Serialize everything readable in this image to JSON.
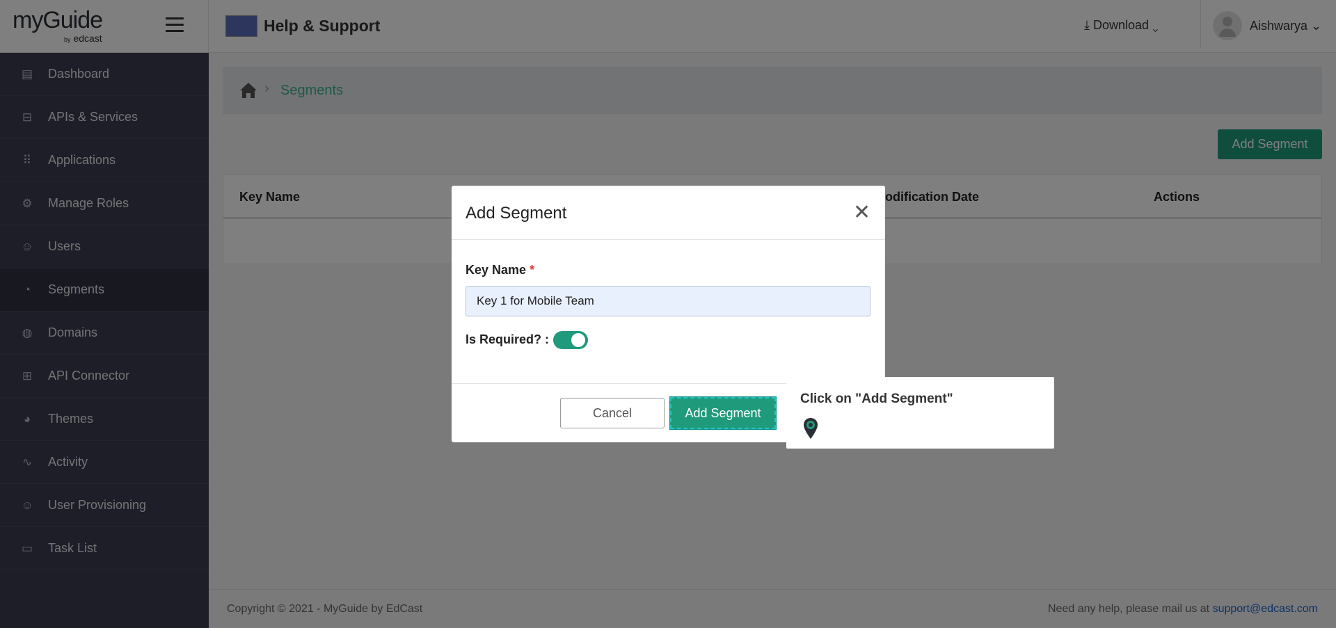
{
  "header": {
    "logo": "myGuide",
    "logo_sub_prefix": "by",
    "logo_sub": "edcast",
    "app_title": "Help & Support",
    "download_label": "Download",
    "username": "Aishwarya"
  },
  "sidebar": {
    "items": [
      {
        "label": "Dashboard",
        "icon": "dashboard-icon",
        "active": false
      },
      {
        "label": "APIs & Services",
        "icon": "api-icon",
        "active": false
      },
      {
        "label": "Applications",
        "icon": "grid-icon",
        "active": false
      },
      {
        "label": "Manage Roles",
        "icon": "user-gear-icon",
        "active": false
      },
      {
        "label": "Users",
        "icon": "users-icon",
        "active": false
      },
      {
        "label": "Segments",
        "icon": "pie-chart-icon",
        "active": true
      },
      {
        "label": "Domains",
        "icon": "globe-icon",
        "active": false
      },
      {
        "label": "API Connector",
        "icon": "api-connector-icon",
        "active": false
      },
      {
        "label": "Themes",
        "icon": "palette-icon",
        "active": false
      },
      {
        "label": "Activity",
        "icon": "activity-icon",
        "active": false
      },
      {
        "label": "User Provisioning",
        "icon": "users-icon",
        "active": false
      },
      {
        "label": "Task List",
        "icon": "clipboard-icon",
        "active": false
      }
    ]
  },
  "breadcrumb": {
    "current": "Segments"
  },
  "main": {
    "add_button": "Add Segment",
    "table_headers": [
      "Key Name",
      "Modification Date",
      "Actions"
    ]
  },
  "modal": {
    "title": "Add Segment",
    "key_name_label": "Key Name",
    "required_mark": "*",
    "key_name_value": "Key 1 for Mobile Team",
    "is_required_label": "Is Required? :",
    "is_required": true,
    "cancel_label": "Cancel",
    "submit_label": "Add Segment"
  },
  "tooltip": {
    "text": "Click on \"Add Segment\""
  },
  "footer": {
    "copyright": "Copyright © 2021 - MyGuide by EdCast",
    "help_text": "Need any help, please mail us at",
    "help_email": "support@edcast.com"
  },
  "colors": {
    "accent": "#1f9a7a",
    "sidebar_bg": "#3a3d4e",
    "link": "#1a63c9"
  }
}
